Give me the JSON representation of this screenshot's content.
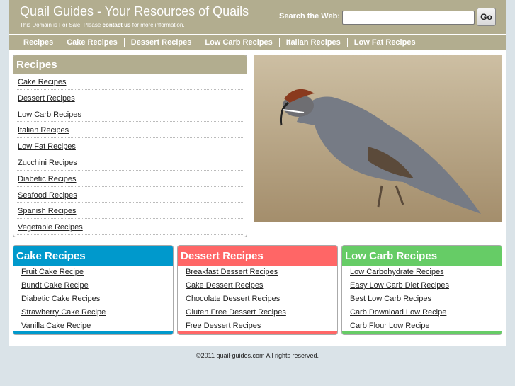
{
  "header": {
    "title": "Quail Guides - Your Resources of Quails",
    "sub_pre": "This Domain is For Sale. Please ",
    "sub_link": "contact us",
    "sub_post": " for more information.",
    "search_label": "Search the Web:",
    "search_value": "",
    "go_label": "Go"
  },
  "nav": [
    "Recipes",
    "Cake Recipes",
    "Dessert Recipes",
    "Low Carb Recipes",
    "Italian Recipes",
    "Low Fat Recipes"
  ],
  "sidebar": {
    "title": "Recipes",
    "items": [
      "Cake Recipes",
      "Dessert Recipes",
      "Low Carb Recipes",
      "Italian Recipes",
      "Low Fat Recipes",
      "Zucchini Recipes",
      "Diabetic Recipes",
      "Seafood Recipes",
      "Spanish Recipes",
      "Vegetable Recipes"
    ]
  },
  "boxes": [
    {
      "title": "Cake Recipes",
      "color": "#0099cc",
      "items": [
        "Fruit Cake Recipe",
        "Bundt Cake Recipe",
        "Diabetic Cake Recipes",
        "Strawberry Cake Recipe",
        "Vanilla Cake Recipe"
      ]
    },
    {
      "title": "Dessert Recipes",
      "color": "#ff6666",
      "items": [
        "Breakfast Dessert Recipes",
        "Cake Dessert Recipes",
        "Chocolate Dessert Recipes",
        "Gluten Free Dessert Recipes",
        "Free Dessert Recipes"
      ]
    },
    {
      "title": "Low Carb Recipes",
      "color": "#66cc66",
      "items": [
        "Low Carbohydrate Recipes",
        "Easy Low Carb Diet Recipes",
        "Best Low Carb Recipes",
        "Carb Download Low Recipe",
        "Carb Flour Low Recipe"
      ]
    }
  ],
  "footer": "©2011 quail-guides.com All rights reserved."
}
